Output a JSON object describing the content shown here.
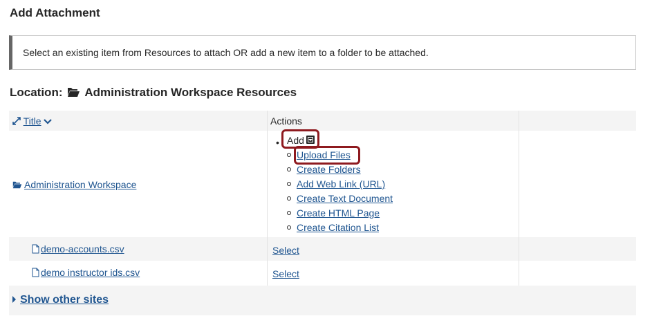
{
  "page_title": "Add Attachment",
  "instruction": "Select an existing item from Resources to attach OR add a new item to a folder to be attached.",
  "location": {
    "label": "Location:",
    "icon": "folder-open-icon",
    "name": "Administration Workspace Resources"
  },
  "table": {
    "headers": {
      "title": "Title",
      "actions": "Actions"
    },
    "folder": {
      "name": "Administration Workspace",
      "add_menu": {
        "label": "Add",
        "items": [
          "Upload Files",
          "Create Folders",
          "Add Web Link (URL)",
          "Create Text Document",
          "Create HTML Page",
          "Create Citation List"
        ]
      }
    },
    "files": [
      {
        "name": "demo-accounts.csv",
        "action": "Select"
      },
      {
        "name": "demo instructor ids.csv",
        "action": "Select"
      }
    ],
    "show_other_sites": "Show other sites"
  },
  "colors": {
    "link": "#1f5590",
    "highlight": "#8e1a1f",
    "row_alt": "#f4f4f4"
  }
}
